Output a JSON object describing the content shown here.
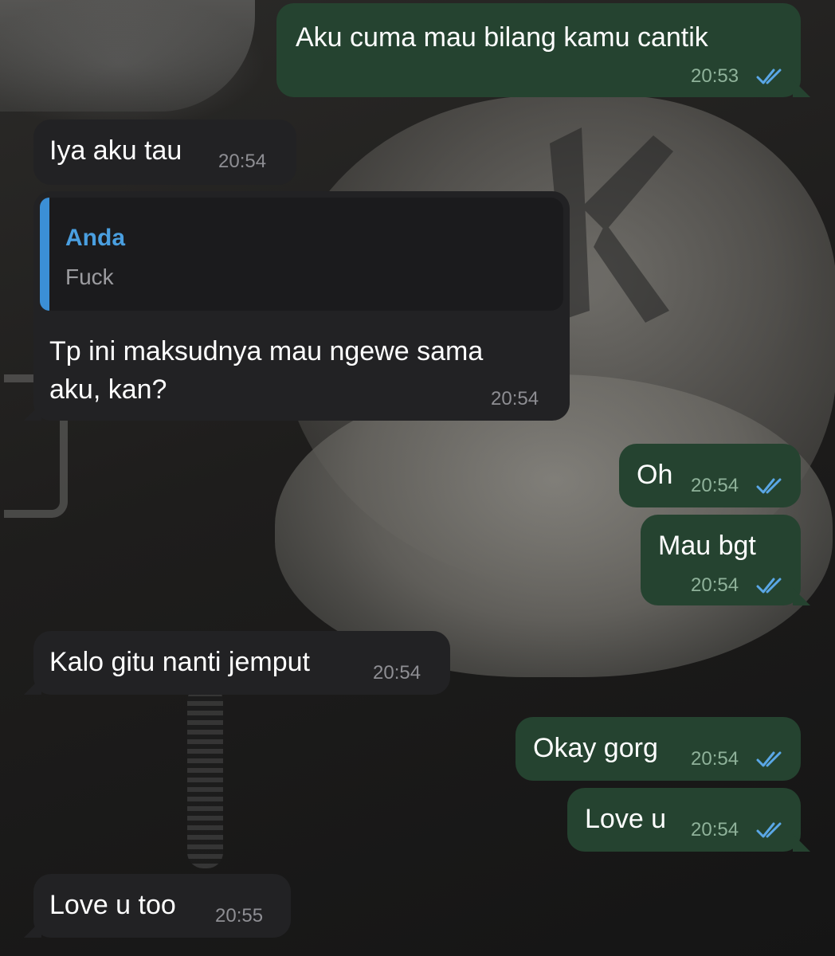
{
  "conversation": {
    "reply_quote": {
      "name": "Anda",
      "text": "Fuck"
    },
    "messages": [
      {
        "text": "Aku cuma mau bilang kamu cantik",
        "time": "20:53",
        "direction": "outgoing",
        "status": "read-double-check-icon"
      },
      {
        "text": "Iya aku tau",
        "time": "20:54",
        "direction": "incoming"
      },
      {
        "text_line1": "Tp ini maksudnya mau ngewe sama",
        "text_line2": "aku, kan?",
        "time": "20:54",
        "direction": "incoming"
      },
      {
        "text": "Oh",
        "time": "20:54",
        "direction": "outgoing",
        "status": "read-double-check-icon"
      },
      {
        "text": "Mau bgt",
        "time": "20:54",
        "direction": "outgoing",
        "status": "read-double-check-icon"
      },
      {
        "text": "Kalo gitu nanti jemput",
        "time": "20:54",
        "direction": "incoming"
      },
      {
        "text": "Okay gorg",
        "time": "20:54",
        "direction": "outgoing",
        "status": "read-double-check-icon"
      },
      {
        "text": "Love u",
        "time": "20:54",
        "direction": "outgoing",
        "status": "read-double-check-icon"
      },
      {
        "text": "Love u too",
        "time": "20:55",
        "direction": "incoming"
      }
    ]
  },
  "colors": {
    "outgoing_bubble": "#254330",
    "incoming_bubble": "#222224",
    "read_ticks": "#5aa7e6",
    "reply_accent": "#3b8fd6"
  }
}
